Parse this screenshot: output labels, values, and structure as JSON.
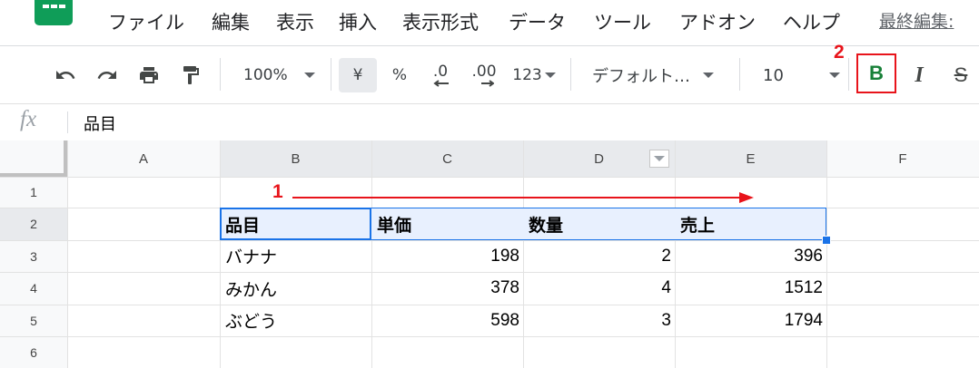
{
  "menu": {
    "items": [
      "ファイル",
      "編集",
      "表示",
      "挿入",
      "表示形式",
      "データ",
      "ツール",
      "アドオン",
      "ヘルプ"
    ],
    "last_edit": "最終編集: "
  },
  "toolbar": {
    "zoom": "100%",
    "currency": "¥",
    "percent": "%",
    "dec_decrease": ".0",
    "dec_increase": ".00",
    "more_formats": "123",
    "font": "デフォルト…",
    "font_size": "10",
    "bold": "B",
    "italic": "I",
    "strike": "S"
  },
  "formula_bar": {
    "fx": "fx",
    "value": "品目"
  },
  "grid": {
    "columns": [
      "A",
      "B",
      "C",
      "D",
      "E",
      "F"
    ],
    "rows": [
      "1",
      "2",
      "3",
      "4",
      "5",
      "6"
    ],
    "header_row": [
      "品目",
      "単価",
      "数量",
      "売上"
    ],
    "data": [
      [
        "バナナ",
        "198",
        "2",
        "396"
      ],
      [
        "みかん",
        "378",
        "4",
        "1512"
      ],
      [
        "ぶどう",
        "598",
        "3",
        "1794"
      ]
    ]
  },
  "annotations": {
    "step1": "1",
    "step2": "2",
    "color": "#e8141b"
  },
  "colors": {
    "selection_border": "#1a73e8",
    "selection_fill": "#e8f0fe",
    "header_bg": "#f8f9fa",
    "active_header_bg": "#e8eaed",
    "brand": "#0f9d58"
  }
}
